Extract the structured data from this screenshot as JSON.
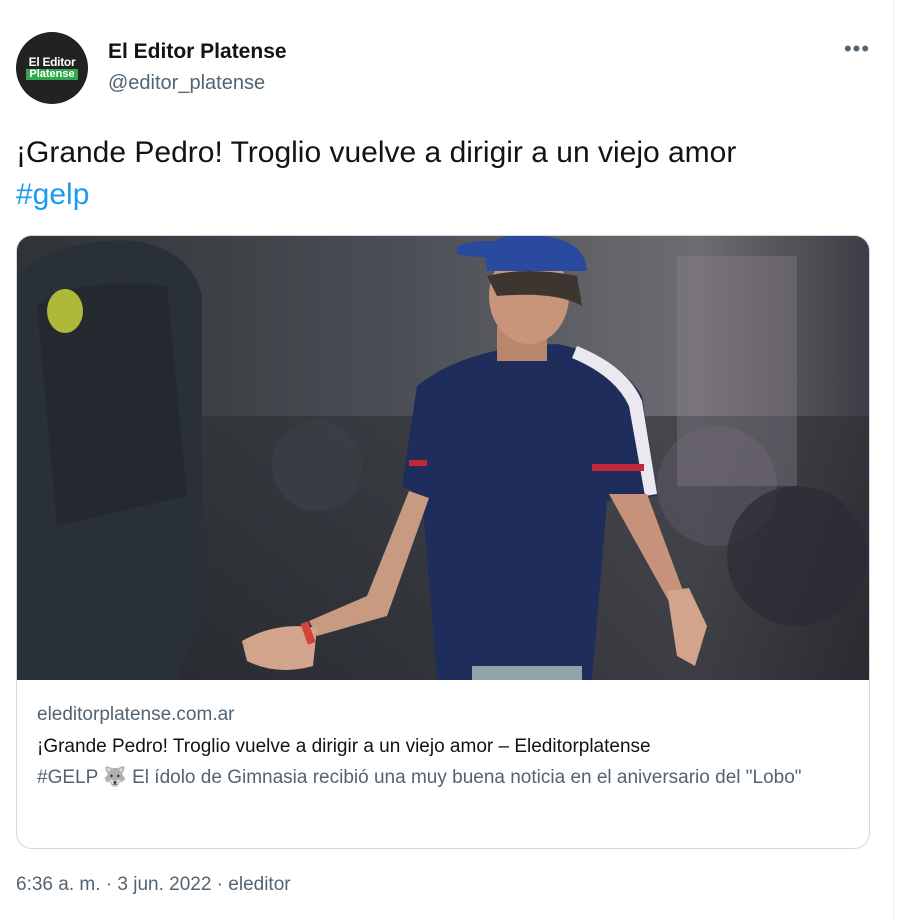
{
  "tweet": {
    "author": {
      "display_name": "El Editor Platense",
      "handle": "@editor_platense",
      "avatar_line1": "El Editor",
      "avatar_line2": "Platense"
    },
    "more_icon": "more-horizontal-icon",
    "text": "¡Grande Pedro! Troglio vuelve a dirigir a un viejo amor",
    "hashtag": "#gelp",
    "card": {
      "domain": "eleditorplatense.com.ar",
      "title": "¡Grande Pedro! Troglio vuelve a dirigir a un viejo amor  – Eleditorplatense",
      "description": "#GELP 🐺 El ídolo de Gimnasia recibió una muy buena noticia en el aniversario del \"Lobo\""
    },
    "footer": "6:36 a. m. · 3 jun. 2022 · eleditor"
  },
  "colors": {
    "link": "#1d9bf0",
    "secondary_text": "#536471",
    "primary_text": "#0f1419",
    "border": "#cfd9de"
  }
}
